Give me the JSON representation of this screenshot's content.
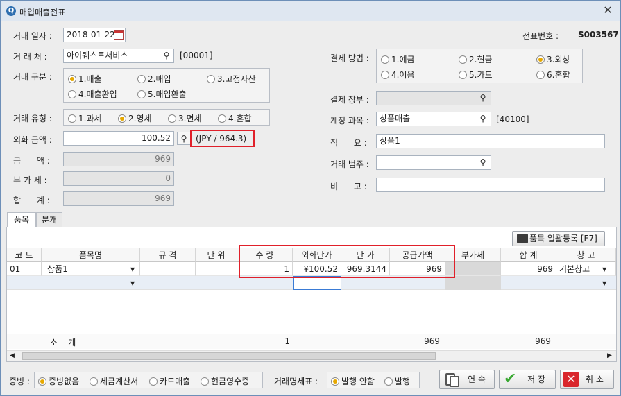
{
  "window": {
    "title": "매입매출전표",
    "close_label": "✕"
  },
  "header": {
    "date_label": "거래 일자 :",
    "date_value": "2018-01-22",
    "voucher_label": "전표번호 :",
    "voucher_value": "S003567",
    "partner_label": "거 래 처 :",
    "partner_value": "아이퀘스트서비스",
    "partner_code": "[00001]",
    "trade_type_label": "거래 구분 :",
    "trade_types": [
      "1.매출",
      "2.매입",
      "3.고정자산",
      "4.매출환입",
      "5.매입환출"
    ],
    "tax_type_label": "거래 유형 :",
    "tax_types": [
      "1.과세",
      "2.영세",
      "3.면세",
      "4.혼합"
    ],
    "fx_label": "외화 금액 :",
    "fx_value": "100.52",
    "fx_rate": "(JPY / 964.3)",
    "amount_label": "금      액 :",
    "amount_value": "969",
    "vat_label": "부 가 세 :",
    "vat_value": "0",
    "total_label": "합      계 :",
    "total_value": "969",
    "pay_label": "결제 방법 :",
    "pay_methods": [
      "1.예금",
      "2.현금",
      "3.외상",
      "4.어음",
      "5.카드",
      "6.혼합"
    ],
    "ledger_label": "결제 장부 :",
    "account_label": "계정 과목 :",
    "account_value": "상품매출",
    "account_code": "[40100]",
    "memo_label": "적      요 :",
    "memo_value": "상품1",
    "category_label": "거래 범주 :",
    "note_label": "비      고 :"
  },
  "tabs": [
    "품목",
    "분개"
  ],
  "grid": {
    "bulk_button": "품목 일괄등록 [F7]",
    "columns": [
      "코 드",
      "품목명",
      "규 격",
      "단 위",
      "수 량",
      "외화단가",
      "단 가",
      "공급가액",
      "부가세",
      "합 계",
      "창 고"
    ],
    "rows": [
      [
        "01",
        "상품1",
        "",
        "",
        "1",
        "¥100.52",
        "969.3144",
        "969",
        "",
        "969",
        "기본창고"
      ]
    ],
    "subtotal": {
      "label": "소    계",
      "qty": "1",
      "supply": "969",
      "total": "969"
    }
  },
  "footer": {
    "proof_label": "증빙 :",
    "proofs": [
      "증빙없음",
      "세금계산서",
      "카드매출",
      "현금영수증"
    ],
    "stmt_label": "거래명세표 :",
    "stmts": [
      "발행 안함",
      "발행"
    ],
    "continue_label": "연 속",
    "save_label": "저 장",
    "cancel_label": "취 소"
  },
  "colors": {
    "accent": "#e6a800",
    "highlight": "#e0202a"
  }
}
